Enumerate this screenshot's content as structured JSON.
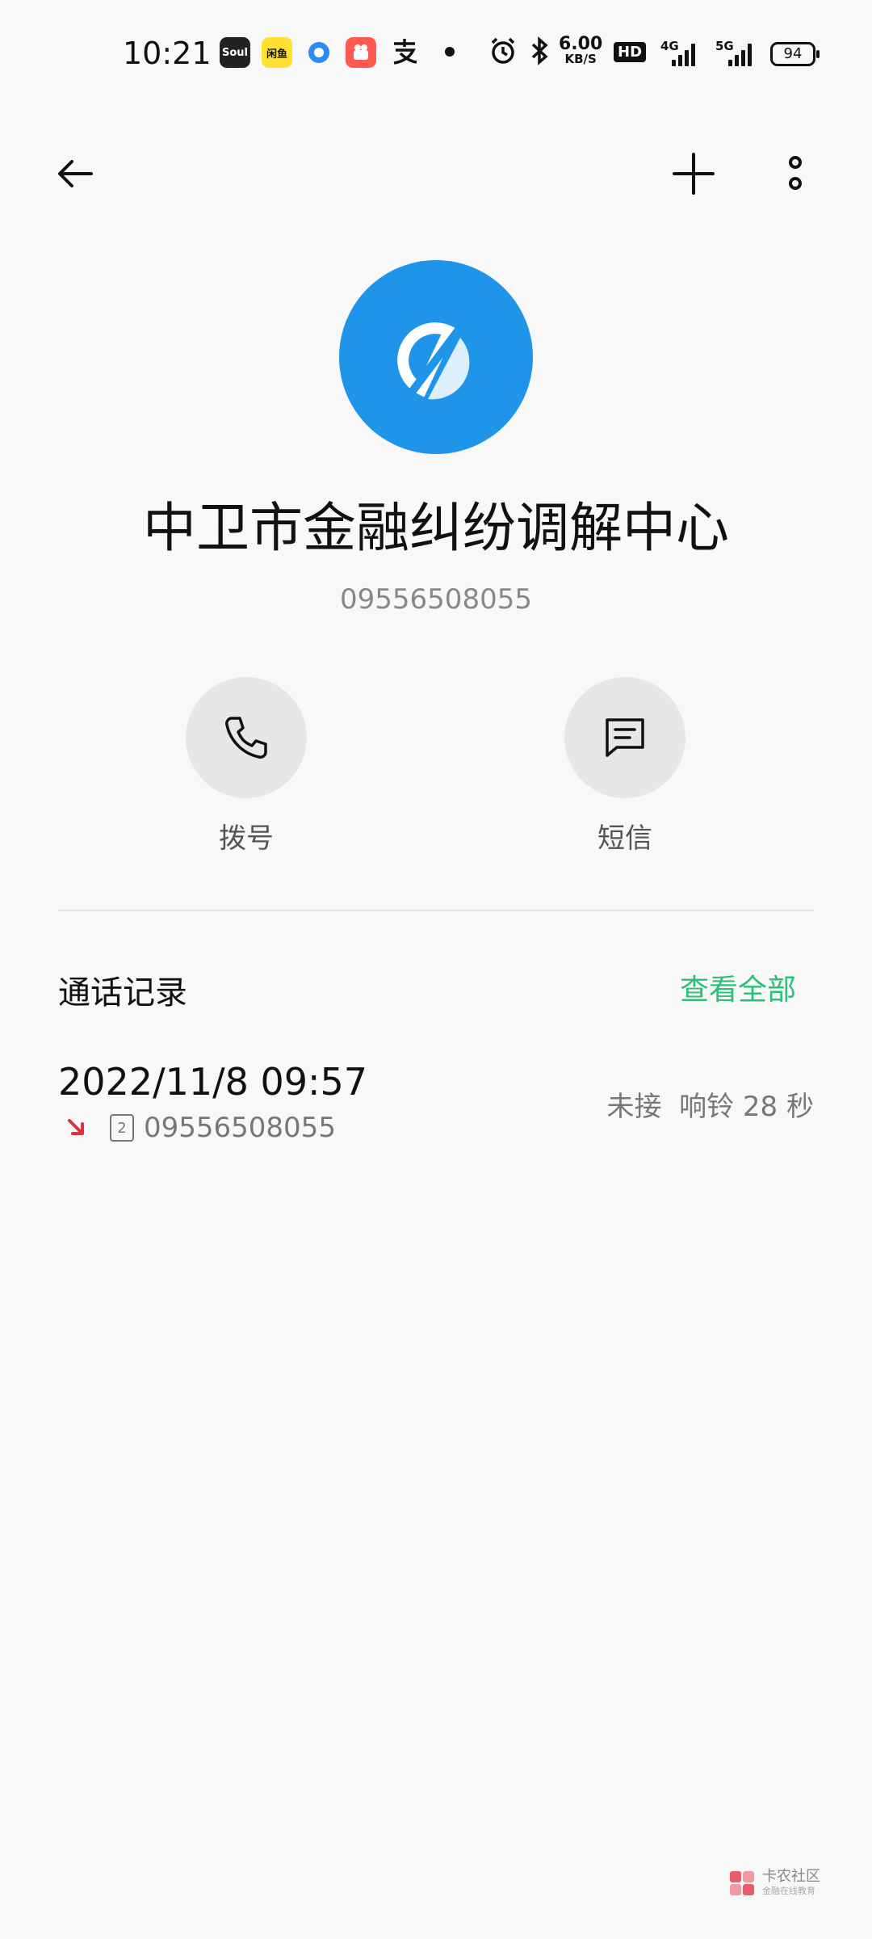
{
  "status_bar": {
    "time": "10:21",
    "apps": [
      "Soul",
      "闲鱼"
    ],
    "net_speed_value": "6.00",
    "net_speed_unit": "KB/S",
    "hd_label": "HD",
    "signal_1_label": "4G",
    "signal_2_label": "5G",
    "battery": "94"
  },
  "contact": {
    "name": "中卫市金融纠纷调解中心",
    "number": "09556508055"
  },
  "actions": {
    "dial_label": "拨号",
    "sms_label": "短信"
  },
  "call_log": {
    "title": "通话记录",
    "view_all": "查看全部",
    "entries": [
      {
        "datetime": "2022/11/8 09:57",
        "sim": "2",
        "number": "09556508055",
        "status": "未接  响铃 28 秒"
      }
    ]
  },
  "watermark": {
    "title": "卡农社区",
    "subtitle": "金融在线教育"
  },
  "colors": {
    "avatar_bg": "#1e95e8",
    "accent_green": "#2dbf79",
    "missed_red": "#e0323c"
  }
}
